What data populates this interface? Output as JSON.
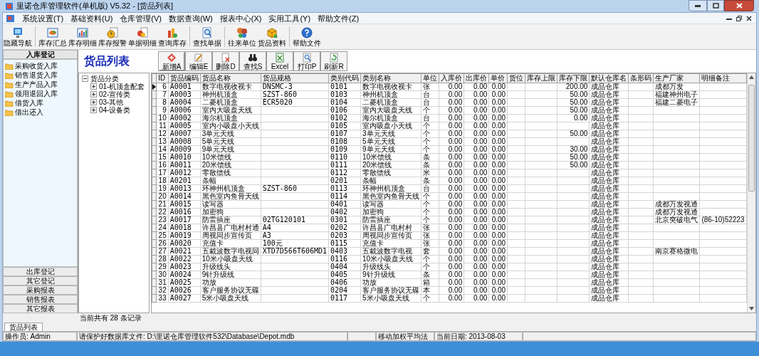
{
  "window": {
    "title": "里诺仓库管理软件(单机版) V5.32 - [货品列表]"
  },
  "menu": [
    "系统设置(T)",
    "基础资料(U)",
    "仓库管理(V)",
    "数据查询(W)",
    "报表中心(X)",
    "实用工具(Y)",
    "帮助文件(Z)"
  ],
  "toolbar": [
    "隐藏导航",
    "库存汇总",
    "库存明细",
    "库存报警",
    "单据明细",
    "查询库存",
    "查找单据",
    "往来单位",
    "货品资料",
    "帮助文件"
  ],
  "nav": [
    {
      "label": "入库登记",
      "selected": true,
      "items": [
        "采购收货入库",
        "销售退货入库",
        "生产产品入库",
        "领用退回入库",
        "借货入库",
        "借出还入"
      ]
    },
    {
      "label": "出库登记",
      "selected": false
    },
    {
      "label": "其它登记",
      "selected": false
    },
    {
      "label": "采购报表",
      "selected": false
    },
    {
      "label": "销售报表",
      "selected": false
    },
    {
      "label": "其它报表",
      "selected": false
    }
  ],
  "content": {
    "title": "货品列表",
    "buttons": [
      "新增A",
      "编辑E",
      "删除D",
      "查找S",
      "Excel",
      "打印P",
      "刷新R"
    ]
  },
  "tree": {
    "label": "货品分类",
    "expanded": true,
    "children": [
      {
        "label": "01-机顶盒配套",
        "expanded": false
      },
      {
        "label": "02-宣传类",
        "expanded": false
      },
      {
        "label": "03-其他",
        "expanded": false
      },
      {
        "label": "04-设备类",
        "expanded": false
      }
    ]
  },
  "table": {
    "columns": [
      "ID",
      "货品编码",
      "货品名称",
      "货品规格",
      "类别代码",
      "类别名称",
      "单位",
      "入库价",
      "出库价",
      "单价",
      "货位",
      "库存上限",
      "库存下限",
      "默认仓库名",
      "条形码",
      "生产厂家",
      "明细备注"
    ],
    "rows": [
      {
        "selected": true,
        "id": "6",
        "code": "A0001",
        "name": "数字电视收视卡",
        "spec": "DNSMC-3",
        "class_code": "0101",
        "class_name": "数字电视收视卡",
        "unit": "张",
        "in_price": "0.00",
        "out_price": "0.00",
        "price": "0.00",
        "min_stock": "200.00",
        "warehouse": "成品仓库",
        "maker": "成都万发"
      },
      {
        "selected": false,
        "id": "7",
        "code": "A0003",
        "name": "神州机顶盒",
        "spec": "SZST-860",
        "class_code": "0103",
        "class_name": "神州机顶盒",
        "unit": "台",
        "in_price": "0.00",
        "out_price": "0.00",
        "price": "0.00",
        "min_stock": "50.00",
        "warehouse": "成品仓库",
        "maker": "福建神州电子"
      },
      {
        "selected": false,
        "id": "8",
        "code": "A0004",
        "name": "二菱机顶盒",
        "spec": "ECR5020",
        "class_code": "0104",
        "class_name": "二菱机顶盒",
        "unit": "台",
        "in_price": "0.00",
        "out_price": "0.00",
        "price": "0.00",
        "min_stock": "50.00",
        "warehouse": "成品仓库",
        "maker": "福建二菱电子"
      },
      {
        "selected": false,
        "id": "9",
        "code": "A0006",
        "name": "室内大吸盘天线",
        "class_code": "0106",
        "class_name": "室内大吸盘天线",
        "unit": "个",
        "in_price": "0.00",
        "out_price": "0.00",
        "price": "0.00",
        "min_stock": "50.00",
        "warehouse": "成品仓库"
      },
      {
        "selected": false,
        "id": "10",
        "code": "A0002",
        "name": "海尔机顶盒",
        "class_code": "0102",
        "class_name": "海尔机顶盒",
        "unit": "台",
        "in_price": "0.00",
        "out_price": "0.00",
        "price": "0.00",
        "min_stock": "0.00",
        "warehouse": "成品仓库"
      },
      {
        "selected": false,
        "id": "11",
        "code": "A0005",
        "name": "室内小吸盘小天线",
        "class_code": "0105",
        "class_name": "室内吸盘小天线",
        "unit": "个",
        "in_price": "0.00",
        "out_price": "0.00",
        "price": "0.00",
        "warehouse": "成品仓库"
      },
      {
        "selected": false,
        "id": "12",
        "code": "A0007",
        "name": "3单元天线",
        "class_code": "0107",
        "class_name": "3单元天线",
        "unit": "个",
        "in_price": "0.00",
        "out_price": "0.00",
        "price": "0.00",
        "min_stock": "50.00",
        "warehouse": "成品仓库"
      },
      {
        "selected": false,
        "id": "13",
        "code": "A0008",
        "name": "5单元天线",
        "class_code": "0108",
        "class_name": "5单元天线",
        "unit": "个",
        "in_price": "0.00",
        "out_price": "0.00",
        "price": "0.00",
        "warehouse": "成品仓库"
      },
      {
        "selected": false,
        "id": "14",
        "code": "A0009",
        "name": "9单元天线",
        "class_code": "0109",
        "class_name": "9单元天线",
        "unit": "个",
        "in_price": "0.00",
        "out_price": "0.00",
        "price": "0.00",
        "min_stock": "30.00",
        "warehouse": "成品仓库"
      },
      {
        "selected": false,
        "id": "15",
        "code": "A0010",
        "name": "10米馈线",
        "class_code": "0110",
        "class_name": "10米馈线",
        "unit": "条",
        "in_price": "0.00",
        "out_price": "0.00",
        "price": "0.00",
        "min_stock": "50.00",
        "warehouse": "成品仓库"
      },
      {
        "selected": false,
        "id": "16",
        "code": "A0011",
        "name": "20米馈线",
        "class_code": "0111",
        "class_name": "20米馈线",
        "unit": "条",
        "in_price": "0.00",
        "out_price": "0.00",
        "price": "0.00",
        "min_stock": "50.00",
        "warehouse": "成品仓库"
      },
      {
        "selected": false,
        "id": "17",
        "code": "A0012",
        "name": "零散馈线",
        "class_code": "0112",
        "class_name": "零散馈线",
        "unit": "米",
        "in_price": "0.00",
        "out_price": "0.00",
        "price": "0.00",
        "warehouse": "成品仓库"
      },
      {
        "selected": false,
        "id": "18",
        "code": "A0201",
        "name": "条幅",
        "class_code": "0201",
        "class_name": "条幅",
        "unit": "条",
        "in_price": "0.00",
        "out_price": "0.00",
        "price": "0.00",
        "warehouse": "成品仓库"
      },
      {
        "selected": false,
        "id": "19",
        "code": "A0013",
        "name": "环神州机顶盒",
        "spec": "SZST-860",
        "class_code": "0113",
        "class_name": "环神州机顶盒",
        "unit": "台",
        "in_price": "0.00",
        "out_price": "0.00",
        "price": "0.00",
        "warehouse": "成品仓库"
      },
      {
        "selected": false,
        "id": "20",
        "code": "A0014",
        "name": "黑色室内鱼骨天线",
        "class_code": "0114",
        "class_name": "黑色室内鱼骨天线",
        "unit": "个",
        "in_price": "0.00",
        "out_price": "0.00",
        "price": "0.00",
        "warehouse": "成品仓库"
      },
      {
        "selected": false,
        "id": "21",
        "code": "A0015",
        "name": "读写器",
        "class_code": "0401",
        "class_name": "读写器",
        "unit": "个",
        "in_price": "0.00",
        "out_price": "0.00",
        "price": "0.00",
        "warehouse": "成品仓库",
        "maker": "成都万发视通"
      },
      {
        "selected": false,
        "id": "22",
        "code": "A0016",
        "name": "加密狗",
        "class_code": "0402",
        "class_name": "加密狗",
        "unit": "个",
        "in_price": "0.00",
        "out_price": "0.00",
        "price": "0.00",
        "warehouse": "成品仓库",
        "maker": "成都万发视通"
      },
      {
        "selected": false,
        "id": "23",
        "code": "A0017",
        "name": "防雷插座",
        "spec": "02TG120101",
        "class_code": "0301",
        "class_name": "防雷插座",
        "unit": "个",
        "in_price": "0.00",
        "out_price": "0.00",
        "price": "0.00",
        "warehouse": "成品仓库",
        "maker": "北京突破电气",
        "note": "(86-10)52223"
      },
      {
        "selected": false,
        "id": "24",
        "code": "A0018",
        "name": "许昌县广电村村通",
        "spec": "A4",
        "class_code": "0202",
        "class_name": "许昌县广电村村",
        "unit": "张",
        "in_price": "0.00",
        "out_price": "0.00",
        "price": "0.00",
        "warehouse": "成品仓库"
      },
      {
        "selected": false,
        "id": "25",
        "code": "A0019",
        "name": "周视同步宣传页",
        "spec": "A3",
        "class_code": "0203",
        "class_name": "周视同步宣传页",
        "unit": "张",
        "in_price": "0.00",
        "out_price": "0.00",
        "price": "0.00",
        "warehouse": "成品仓库"
      },
      {
        "selected": false,
        "id": "26",
        "code": "A0020",
        "name": "充值卡",
        "spec": "100元",
        "class_code": "0115",
        "class_name": "充值卡",
        "unit": "张",
        "in_price": "0.00",
        "out_price": "0.00",
        "price": "0.00",
        "warehouse": "成品仓库"
      },
      {
        "selected": false,
        "id": "27",
        "code": "A0021",
        "name": "五載波数字电视同",
        "spec": "XTD7D566T606MD1",
        "class_code": "0403",
        "class_name": "五載波数字电视",
        "unit": "套",
        "in_price": "0.00",
        "out_price": "0.00",
        "price": "0.00",
        "warehouse": "成品仓库",
        "maker": "南京赛格微电"
      },
      {
        "selected": false,
        "id": "28",
        "code": "A0022",
        "name": "10米小吸盘天线",
        "class_code": "0116",
        "class_name": "10米小吸盘天线",
        "unit": "个",
        "in_price": "0.00",
        "out_price": "0.00",
        "price": "0.00",
        "warehouse": "成品仓库"
      },
      {
        "selected": false,
        "id": "29",
        "code": "A0023",
        "name": "升级线头",
        "class_code": "0404",
        "class_name": "升级线头",
        "unit": "个",
        "in_price": "0.00",
        "out_price": "0.00",
        "price": "0.00",
        "warehouse": "成品仓库"
      },
      {
        "selected": false,
        "id": "30",
        "code": "A0024",
        "name": "9针升级线",
        "class_code": "0405",
        "class_name": "9针升级线",
        "unit": "条",
        "in_price": "0.00",
        "out_price": "0.00",
        "price": "0.00",
        "warehouse": "成品仓库"
      },
      {
        "selected": false,
        "id": "31",
        "code": "A0025",
        "name": "功放",
        "class_code": "0406",
        "class_name": "功放",
        "unit": "箱",
        "in_price": "0.00",
        "out_price": "0.00",
        "price": "0.00",
        "warehouse": "成品仓库"
      },
      {
        "selected": false,
        "id": "32",
        "code": "A0026",
        "name": "客户服务协议无碟",
        "class_code": "0204",
        "class_name": "客户服务协议无碟",
        "unit": "本",
        "in_price": "0.00",
        "out_price": "0.00",
        "price": "0.00",
        "warehouse": "成品仓库"
      },
      {
        "selected": false,
        "id": "33",
        "code": "A0027",
        "name": "5米小吸盘天线",
        "class_code": "0117",
        "class_name": "5米小吸盘天线",
        "unit": "个",
        "in_price": "0.00",
        "out_price": "0.00",
        "price": "0.00",
        "warehouse": "成品仓库"
      }
    ]
  },
  "record_count": "当前共有 28 条记录",
  "doc_tabs": [
    {
      "label": "货品列表",
      "selected": true
    }
  ],
  "status_bar": [
    "操作员: Admin",
    "请保护好数据库文件: D:\\里诺仓库管理软件532\\Database\\Depot.mdb",
    "移动加权平均法",
    "当前日期: 2013-08-03"
  ]
}
